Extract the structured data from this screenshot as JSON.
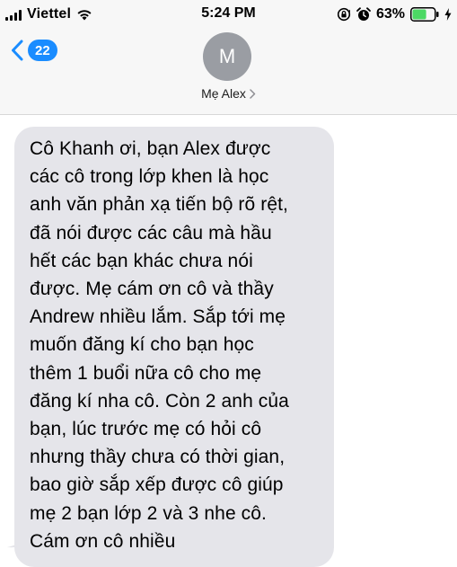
{
  "status_bar": {
    "carrier": "Viettel",
    "time": "5:24 PM",
    "battery_percent": "63%",
    "battery_level": 0.63,
    "icons": [
      "signal-icon",
      "wifi-icon",
      "rotation-lock-icon",
      "alarm-icon",
      "battery-icon",
      "charging-bolt-icon"
    ]
  },
  "nav": {
    "unread_count": "22",
    "avatar_initial": "M",
    "contact_name": "Mẹ Alex",
    "back_icon": "chevron-left-icon",
    "contact_icon": "chevron-right-icon"
  },
  "colors": {
    "accent": "#1a8cff",
    "bubble_incoming": "#e5e5ea",
    "avatar_bg": "#9a9da3",
    "battery_fill": "#4cd964"
  },
  "messages": [
    {
      "direction": "incoming",
      "text": "Cô Khanh ơi, bạn Alex được\ncác cô trong lớp khen là học\nanh văn phản xạ tiến bộ rõ rệt,\nđã nói được các câu mà hầu\nhết các bạn khác chưa nói\nđược. Mẹ cám ơn cô và thầy\nAndrew nhiều lắm. Sắp tới mẹ\nmuốn đăng kí cho bạn học\nthêm 1 buổi nữa cô cho mẹ\nđăng kí nha cô. Còn 2 anh của\nbạn, lúc trước mẹ có hỏi cô\nnhưng thầy chưa có thời gian,\nbao giờ sắp xếp được cô giúp\nmẹ 2 bạn lớp 2 và 3 nhe cô.\nCám ơn cô nhiều"
    }
  ]
}
